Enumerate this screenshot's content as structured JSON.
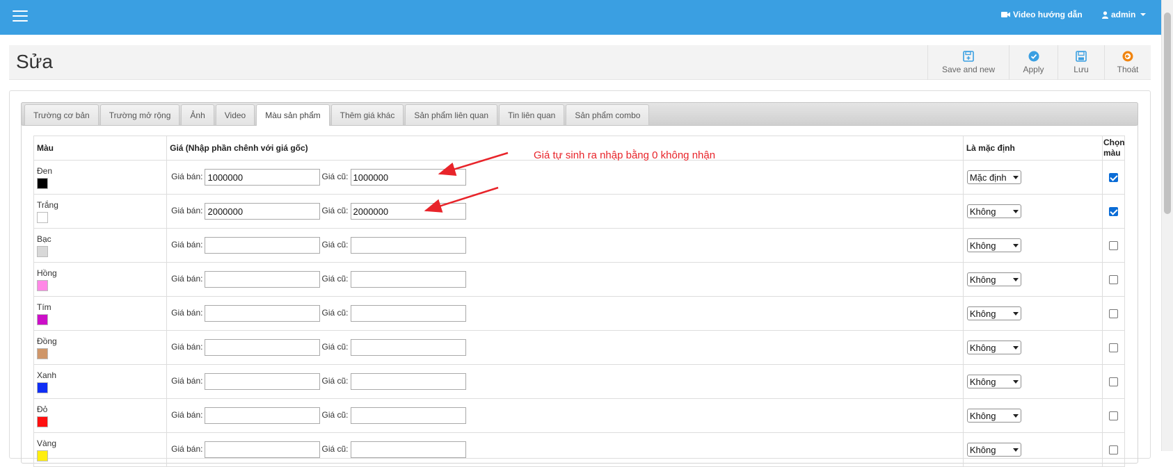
{
  "navbar": {
    "menu_icon": "hamburger-icon",
    "video_label": "Video hướng dẫn",
    "video_icon": "video-camera-icon",
    "user_label": "admin",
    "user_icon": "user-icon",
    "bg_color": "#3a9fe2"
  },
  "header": {
    "title": "Sửa",
    "toolbar": [
      {
        "label": "Save and new",
        "icon": "save-new-icon"
      },
      {
        "label": "Apply",
        "icon": "check-circle-icon"
      },
      {
        "label": "Lưu",
        "icon": "floppy-disk-icon"
      },
      {
        "label": "Thoát",
        "icon": "exit-circle-icon"
      }
    ]
  },
  "tabs": [
    {
      "label": "Trường cơ bản",
      "active": false
    },
    {
      "label": "Trường mở rộng",
      "active": false
    },
    {
      "label": "Ảnh",
      "active": false
    },
    {
      "label": "Video",
      "active": false
    },
    {
      "label": "Màu sản phẩm",
      "active": true
    },
    {
      "label": "Thêm giá khác",
      "active": false
    },
    {
      "label": "Sản phẩm liên quan",
      "active": false
    },
    {
      "label": "Tin liên quan",
      "active": false
    },
    {
      "label": "Sản phẩm combo",
      "active": false
    }
  ],
  "table": {
    "headers": {
      "color": "Màu",
      "price": "Giá (Nhập phần chênh với giá gốc)",
      "default": "Là mặc định",
      "pick": "Chọn màu"
    },
    "sale_label": "Giá bán:",
    "old_label": "Giá cũ:",
    "rows": [
      {
        "name": "Đen",
        "swatch": "#000000",
        "sale": "1000000",
        "old": "1000000",
        "default": "Mặc định",
        "checked": true
      },
      {
        "name": "Trắng",
        "swatch": "#ffffff",
        "sale": "2000000",
        "old": "2000000",
        "default": "Không",
        "checked": true
      },
      {
        "name": "Bạc",
        "swatch": "#d8d8d8",
        "sale": "",
        "old": "",
        "default": "Không",
        "checked": false
      },
      {
        "name": "Hồng",
        "swatch": "#ff88e6",
        "sale": "",
        "old": "",
        "default": "Không",
        "checked": false
      },
      {
        "name": "Tím",
        "swatch": "#cc0fc8",
        "sale": "",
        "old": "",
        "default": "Không",
        "checked": false
      },
      {
        "name": "Đồng",
        "swatch": "#cf9669",
        "sale": "",
        "old": "",
        "default": "Không",
        "checked": false
      },
      {
        "name": "Xanh",
        "swatch": "#0f2ef5",
        "sale": "",
        "old": "",
        "default": "Không",
        "checked": false
      },
      {
        "name": "Đỏ",
        "swatch": "#ff1010",
        "sale": "",
        "old": "",
        "default": "Không",
        "checked": false
      },
      {
        "name": "Vàng",
        "swatch": "#ffee10",
        "sale": "",
        "old": "",
        "default": "Không",
        "checked": false
      }
    ]
  },
  "annotation": {
    "text": "Giá tự sinh ra nhập bằng 0 không nhận",
    "color": "#e8242a"
  }
}
